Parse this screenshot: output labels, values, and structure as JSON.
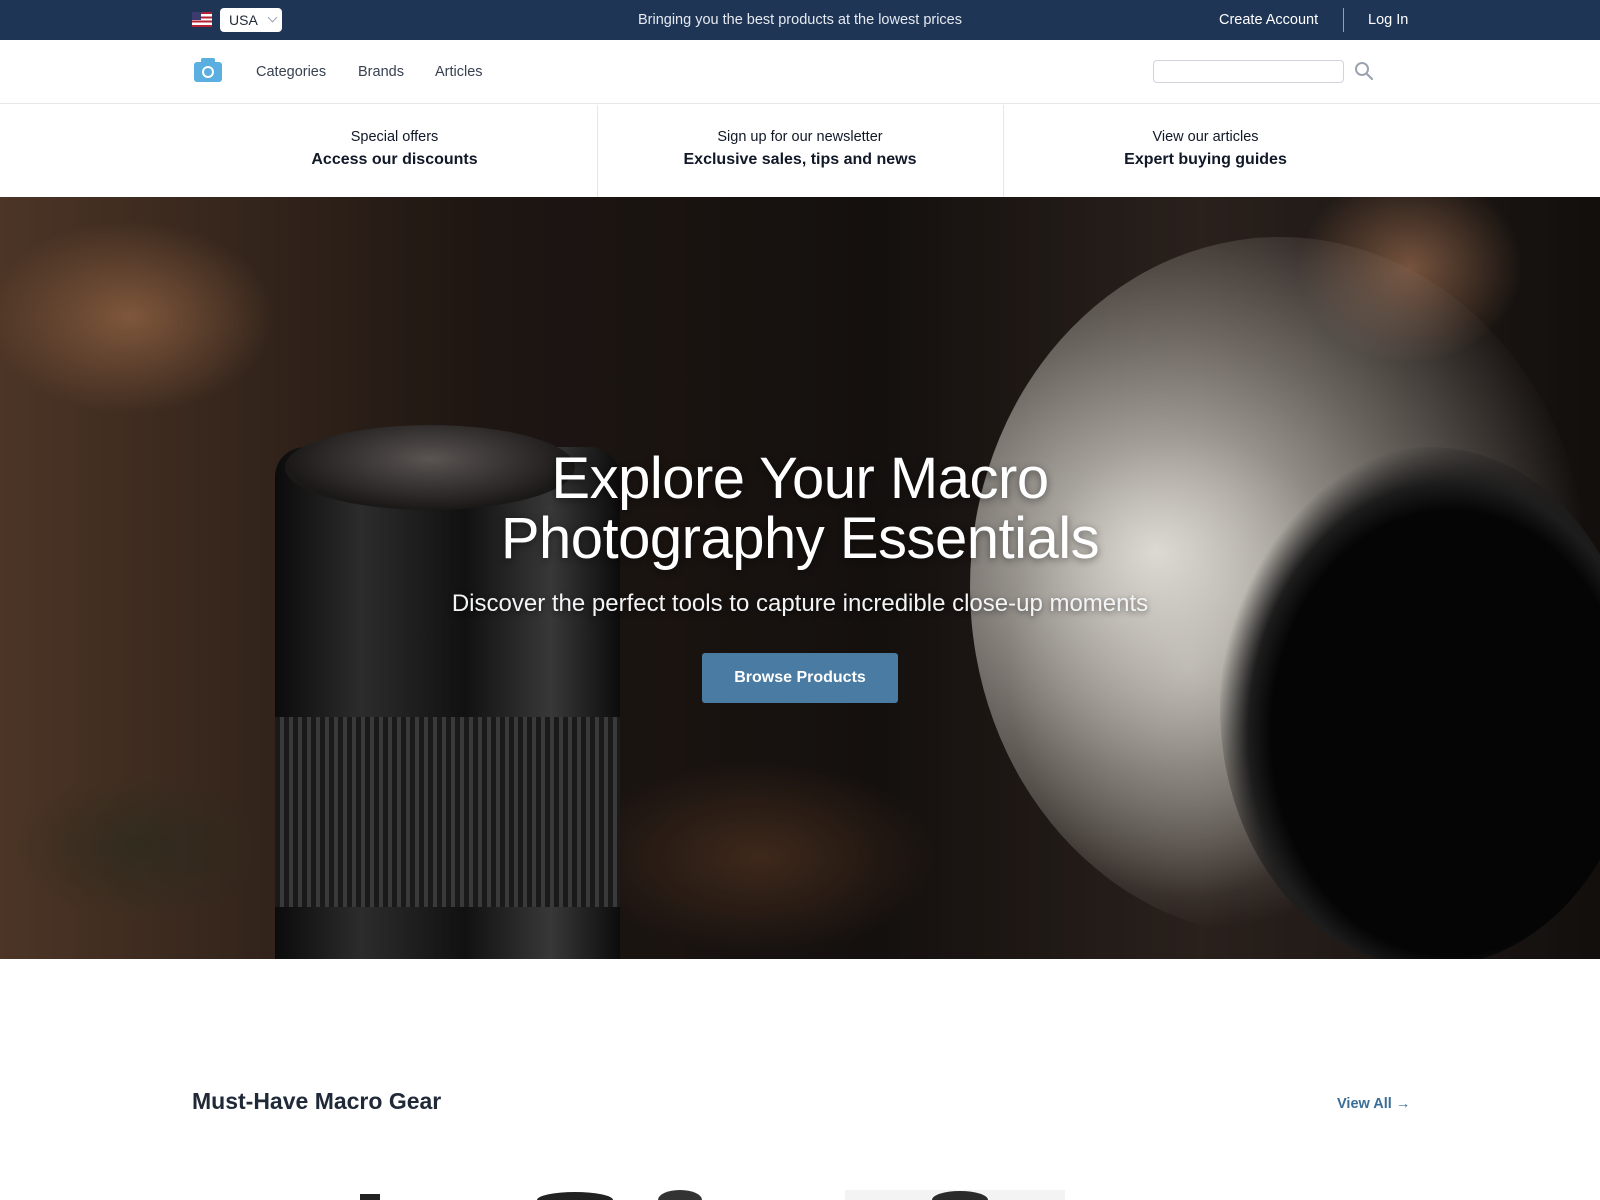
{
  "topbar": {
    "country": "USA",
    "tagline": "Bringing you the best products at the lowest prices",
    "create_account": "Create Account",
    "log_in": "Log In"
  },
  "nav": {
    "links": [
      "Categories",
      "Brands",
      "Articles"
    ],
    "search_placeholder": ""
  },
  "promos": [
    {
      "small": "Special offers",
      "big": "Access our discounts"
    },
    {
      "small": "Sign up for our newsletter",
      "big": "Exclusive sales, tips and news"
    },
    {
      "small": "View our articles",
      "big": "Expert buying guides"
    }
  ],
  "hero": {
    "title_line1": "Explore Your Macro",
    "title_line2": "Photography Essentials",
    "subtitle": "Discover the perfect tools to capture incredible close-up moments",
    "button": "Browse Products"
  },
  "section": {
    "title": "Must-Have Macro Gear",
    "view_all": "View All →"
  },
  "colors": {
    "topbar_bg": "#1f3556",
    "accent": "#4a7ba3",
    "link": "#3b6e97"
  }
}
